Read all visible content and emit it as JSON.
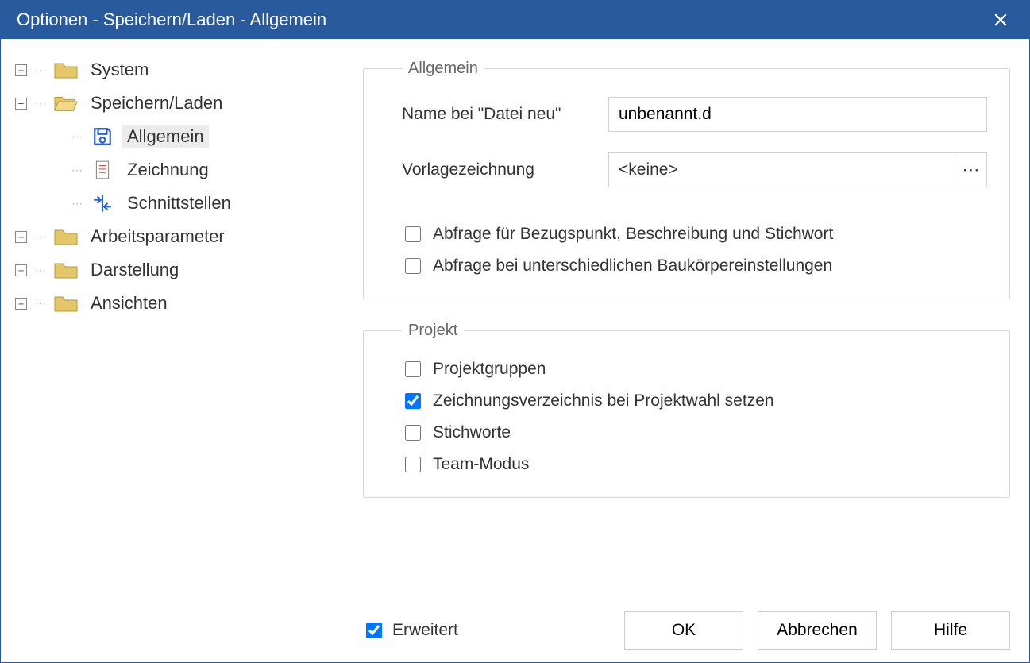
{
  "title": "Optionen - Speichern/Laden - Allgemein",
  "sidebar": {
    "items": [
      {
        "label": "System",
        "expanded": false
      },
      {
        "label": "Speichern/Laden",
        "expanded": true,
        "children": [
          {
            "label": "Allgemein",
            "selected": true
          },
          {
            "label": "Zeichnung"
          },
          {
            "label": "Schnittstellen"
          }
        ]
      },
      {
        "label": "Arbeitsparameter",
        "expanded": false
      },
      {
        "label": "Darstellung",
        "expanded": false
      },
      {
        "label": "Ansichten",
        "expanded": false
      }
    ]
  },
  "group_general": {
    "legend": "Allgemein",
    "name_label": "Name bei \"Datei neu\"",
    "name_value": "unbenannt.d",
    "template_label": "Vorlagezeichnung",
    "template_value": "<keine>",
    "checkbox1": "Abfrage für Bezugspunkt, Beschreibung und Stichwort",
    "checkbox2": "Abfrage bei unterschiedlichen Baukörpereinstellungen"
  },
  "group_project": {
    "legend": "Projekt",
    "cb_groups": "Projektgruppen",
    "cb_drawdir": "Zeichnungsverzeichnis bei Projektwahl setzen",
    "cb_drawdir_checked": true,
    "cb_keywords": "Stichworte",
    "cb_team": "Team-Modus"
  },
  "footer": {
    "extended": "Erweitert",
    "extended_checked": true,
    "ok": "OK",
    "cancel": "Abbrechen",
    "help": "Hilfe"
  }
}
